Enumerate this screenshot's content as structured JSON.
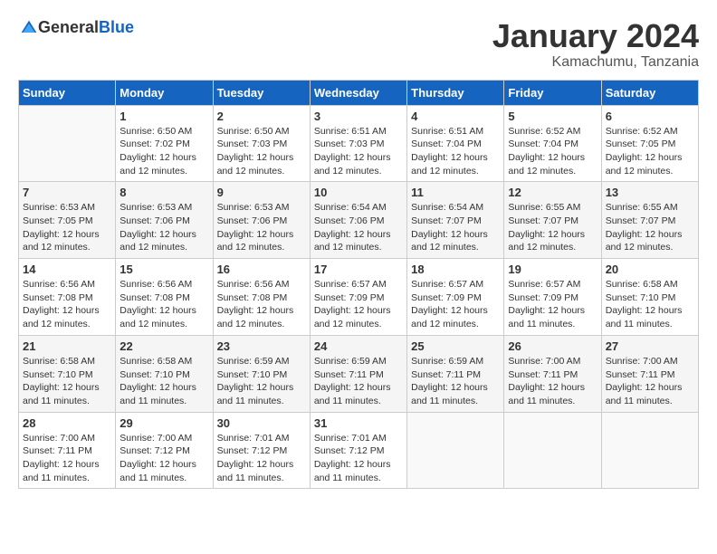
{
  "header": {
    "logo_general": "General",
    "logo_blue": "Blue",
    "title": "January 2024",
    "subtitle": "Kamachumu, Tanzania"
  },
  "calendar": {
    "days_of_week": [
      "Sunday",
      "Monday",
      "Tuesday",
      "Wednesday",
      "Thursday",
      "Friday",
      "Saturday"
    ],
    "weeks": [
      [
        {
          "day": "",
          "sunrise": "",
          "sunset": "",
          "daylight": ""
        },
        {
          "day": "1",
          "sunrise": "Sunrise: 6:50 AM",
          "sunset": "Sunset: 7:02 PM",
          "daylight": "Daylight: 12 hours and 12 minutes."
        },
        {
          "day": "2",
          "sunrise": "Sunrise: 6:50 AM",
          "sunset": "Sunset: 7:03 PM",
          "daylight": "Daylight: 12 hours and 12 minutes."
        },
        {
          "day": "3",
          "sunrise": "Sunrise: 6:51 AM",
          "sunset": "Sunset: 7:03 PM",
          "daylight": "Daylight: 12 hours and 12 minutes."
        },
        {
          "day": "4",
          "sunrise": "Sunrise: 6:51 AM",
          "sunset": "Sunset: 7:04 PM",
          "daylight": "Daylight: 12 hours and 12 minutes."
        },
        {
          "day": "5",
          "sunrise": "Sunrise: 6:52 AM",
          "sunset": "Sunset: 7:04 PM",
          "daylight": "Daylight: 12 hours and 12 minutes."
        },
        {
          "day": "6",
          "sunrise": "Sunrise: 6:52 AM",
          "sunset": "Sunset: 7:05 PM",
          "daylight": "Daylight: 12 hours and 12 minutes."
        }
      ],
      [
        {
          "day": "7",
          "sunrise": "Sunrise: 6:53 AM",
          "sunset": "Sunset: 7:05 PM",
          "daylight": "Daylight: 12 hours and 12 minutes."
        },
        {
          "day": "8",
          "sunrise": "Sunrise: 6:53 AM",
          "sunset": "Sunset: 7:06 PM",
          "daylight": "Daylight: 12 hours and 12 minutes."
        },
        {
          "day": "9",
          "sunrise": "Sunrise: 6:53 AM",
          "sunset": "Sunset: 7:06 PM",
          "daylight": "Daylight: 12 hours and 12 minutes."
        },
        {
          "day": "10",
          "sunrise": "Sunrise: 6:54 AM",
          "sunset": "Sunset: 7:06 PM",
          "daylight": "Daylight: 12 hours and 12 minutes."
        },
        {
          "day": "11",
          "sunrise": "Sunrise: 6:54 AM",
          "sunset": "Sunset: 7:07 PM",
          "daylight": "Daylight: 12 hours and 12 minutes."
        },
        {
          "day": "12",
          "sunrise": "Sunrise: 6:55 AM",
          "sunset": "Sunset: 7:07 PM",
          "daylight": "Daylight: 12 hours and 12 minutes."
        },
        {
          "day": "13",
          "sunrise": "Sunrise: 6:55 AM",
          "sunset": "Sunset: 7:07 PM",
          "daylight": "Daylight: 12 hours and 12 minutes."
        }
      ],
      [
        {
          "day": "14",
          "sunrise": "Sunrise: 6:56 AM",
          "sunset": "Sunset: 7:08 PM",
          "daylight": "Daylight: 12 hours and 12 minutes."
        },
        {
          "day": "15",
          "sunrise": "Sunrise: 6:56 AM",
          "sunset": "Sunset: 7:08 PM",
          "daylight": "Daylight: 12 hours and 12 minutes."
        },
        {
          "day": "16",
          "sunrise": "Sunrise: 6:56 AM",
          "sunset": "Sunset: 7:08 PM",
          "daylight": "Daylight: 12 hours and 12 minutes."
        },
        {
          "day": "17",
          "sunrise": "Sunrise: 6:57 AM",
          "sunset": "Sunset: 7:09 PM",
          "daylight": "Daylight: 12 hours and 12 minutes."
        },
        {
          "day": "18",
          "sunrise": "Sunrise: 6:57 AM",
          "sunset": "Sunset: 7:09 PM",
          "daylight": "Daylight: 12 hours and 12 minutes."
        },
        {
          "day": "19",
          "sunrise": "Sunrise: 6:57 AM",
          "sunset": "Sunset: 7:09 PM",
          "daylight": "Daylight: 12 hours and 11 minutes."
        },
        {
          "day": "20",
          "sunrise": "Sunrise: 6:58 AM",
          "sunset": "Sunset: 7:10 PM",
          "daylight": "Daylight: 12 hours and 11 minutes."
        }
      ],
      [
        {
          "day": "21",
          "sunrise": "Sunrise: 6:58 AM",
          "sunset": "Sunset: 7:10 PM",
          "daylight": "Daylight: 12 hours and 11 minutes."
        },
        {
          "day": "22",
          "sunrise": "Sunrise: 6:58 AM",
          "sunset": "Sunset: 7:10 PM",
          "daylight": "Daylight: 12 hours and 11 minutes."
        },
        {
          "day": "23",
          "sunrise": "Sunrise: 6:59 AM",
          "sunset": "Sunset: 7:10 PM",
          "daylight": "Daylight: 12 hours and 11 minutes."
        },
        {
          "day": "24",
          "sunrise": "Sunrise: 6:59 AM",
          "sunset": "Sunset: 7:11 PM",
          "daylight": "Daylight: 12 hours and 11 minutes."
        },
        {
          "day": "25",
          "sunrise": "Sunrise: 6:59 AM",
          "sunset": "Sunset: 7:11 PM",
          "daylight": "Daylight: 12 hours and 11 minutes."
        },
        {
          "day": "26",
          "sunrise": "Sunrise: 7:00 AM",
          "sunset": "Sunset: 7:11 PM",
          "daylight": "Daylight: 12 hours and 11 minutes."
        },
        {
          "day": "27",
          "sunrise": "Sunrise: 7:00 AM",
          "sunset": "Sunset: 7:11 PM",
          "daylight": "Daylight: 12 hours and 11 minutes."
        }
      ],
      [
        {
          "day": "28",
          "sunrise": "Sunrise: 7:00 AM",
          "sunset": "Sunset: 7:11 PM",
          "daylight": "Daylight: 12 hours and 11 minutes."
        },
        {
          "day": "29",
          "sunrise": "Sunrise: 7:00 AM",
          "sunset": "Sunset: 7:12 PM",
          "daylight": "Daylight: 12 hours and 11 minutes."
        },
        {
          "day": "30",
          "sunrise": "Sunrise: 7:01 AM",
          "sunset": "Sunset: 7:12 PM",
          "daylight": "Daylight: 12 hours and 11 minutes."
        },
        {
          "day": "31",
          "sunrise": "Sunrise: 7:01 AM",
          "sunset": "Sunset: 7:12 PM",
          "daylight": "Daylight: 12 hours and 11 minutes."
        },
        {
          "day": "",
          "sunrise": "",
          "sunset": "",
          "daylight": ""
        },
        {
          "day": "",
          "sunrise": "",
          "sunset": "",
          "daylight": ""
        },
        {
          "day": "",
          "sunrise": "",
          "sunset": "",
          "daylight": ""
        }
      ]
    ]
  }
}
